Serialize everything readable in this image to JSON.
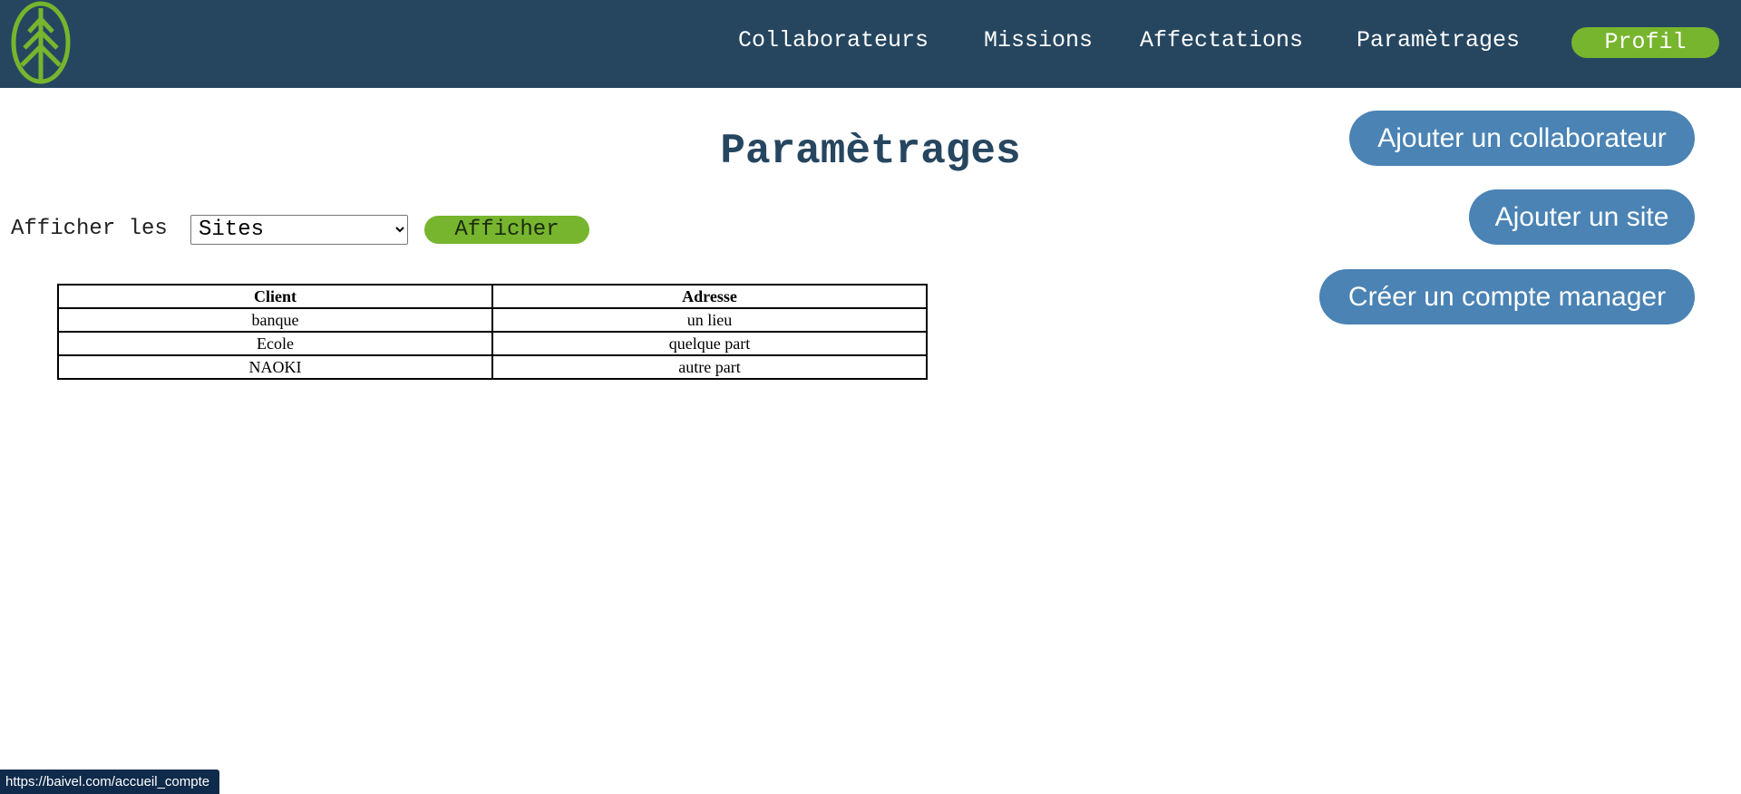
{
  "header": {
    "logo_icon": "pine-tree-logo-icon",
    "nav": [
      {
        "label": "Collaborateurs"
      },
      {
        "label": "Missions"
      },
      {
        "label": "Affectations"
      },
      {
        "label": "Paramètrages"
      }
    ],
    "profil_label": "Profil"
  },
  "main": {
    "title": "Paramètrages",
    "filter": {
      "label": "Afficher les",
      "selected": "Sites",
      "button_label": "Afficher"
    },
    "table": {
      "headers": [
        "Client",
        "Adresse"
      ],
      "rows": [
        [
          "banque",
          "un lieu"
        ],
        [
          "Ecole",
          "quelque part"
        ],
        [
          "NAOKI",
          "autre part"
        ]
      ]
    },
    "actions": [
      {
        "label": "Ajouter un collaborateur"
      },
      {
        "label": "Ajouter un site"
      },
      {
        "label": "Créer un compte manager"
      }
    ]
  },
  "status_bar": {
    "url": "https://baivel.com/accueil_compte"
  },
  "colors": {
    "header_bg": "#264660",
    "accent_green": "#77b52e",
    "action_blue": "#4a83b4",
    "title_color": "#264660"
  }
}
